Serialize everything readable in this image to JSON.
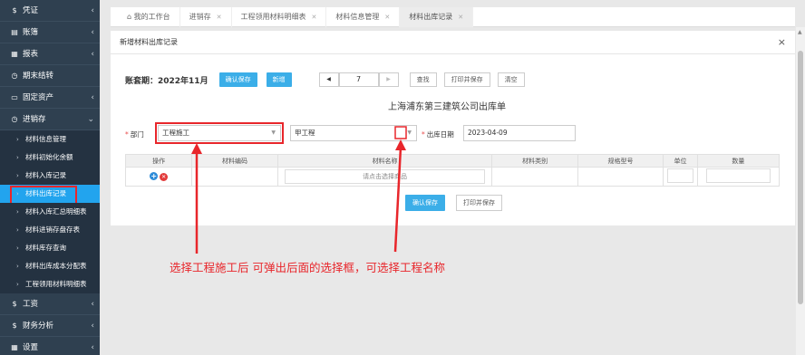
{
  "sidebar": {
    "items": [
      {
        "icon": "$",
        "label": "凭证"
      },
      {
        "icon": "▤",
        "label": "账簿"
      },
      {
        "icon": "▦",
        "label": "报表"
      },
      {
        "icon": "◷",
        "label": "期末结转"
      },
      {
        "icon": "▭",
        "label": "固定资产"
      },
      {
        "icon": "◷",
        "label": "进销存"
      }
    ],
    "subitems": [
      {
        "label": "材料信息管理"
      },
      {
        "label": "材料初始化余额"
      },
      {
        "label": "材料入库记录"
      },
      {
        "label": "材料出库记录",
        "active": true
      },
      {
        "label": "材料入库汇总明细表"
      },
      {
        "label": "材料进销存盘存表"
      },
      {
        "label": "材料库存查询"
      },
      {
        "label": "材料出库成本分配表"
      },
      {
        "label": "工程领用材料明细表"
      }
    ],
    "bottom": [
      {
        "icon": "$",
        "label": "工资"
      },
      {
        "icon": "$",
        "label": "财务分析"
      },
      {
        "icon": "▦",
        "label": "设置"
      }
    ]
  },
  "tabs": [
    {
      "label": "我的工作台",
      "closable": false
    },
    {
      "label": "进销存",
      "closable": true
    },
    {
      "label": "工程领用材料明细表",
      "closable": true
    },
    {
      "label": "材料信息管理",
      "closable": true
    },
    {
      "label": "材料出库记录",
      "closable": true,
      "active": true
    }
  ],
  "dialog": {
    "title": "新增材料出库记录",
    "close": "×"
  },
  "toolbar": {
    "period": "账套期：2022年11月",
    "confirm_save": "确认保存",
    "new": "新增",
    "prev": "◀",
    "page": "7",
    "next": "▶",
    "search": "查找",
    "print_save": "打印并保存",
    "clear": "清空"
  },
  "form": {
    "title": "上海浦东第三建筑公司出库单",
    "dept_label": "部门",
    "dept_value": "工程施工",
    "project_value": "甲工程",
    "date_label": "出库日期",
    "date_value": "2023-04-09"
  },
  "table": {
    "headers": [
      "操作",
      "材料编码",
      "材料名称",
      "材料类别",
      "规格型号",
      "单位",
      "数量"
    ],
    "row_placeholder": "请点击选择商品"
  },
  "bottom": {
    "confirm_save": "确认保存",
    "print_save": "打印并保存"
  },
  "annotation": {
    "text": "选择工程施工后 可弹出后面的选择框，可选择工程名称",
    "color": "#e8262b"
  }
}
